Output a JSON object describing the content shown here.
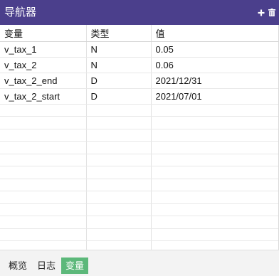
{
  "navigator": {
    "title": "导航器",
    "icons": {
      "add": "plus-icon",
      "delete": "trash-icon"
    },
    "columns": [
      "变量",
      "类型",
      "值"
    ],
    "rows": [
      {
        "name": "v_tax_1",
        "type": "N",
        "value": "0.05"
      },
      {
        "name": "v_tax_2",
        "type": "N",
        "value": "0.06"
      },
      {
        "name": "v_tax_2_end",
        "type": "D",
        "value": "2021/12/31"
      },
      {
        "name": "v_tax_2_start",
        "type": "D",
        "value": "2021/07/01"
      }
    ]
  },
  "tabs": [
    {
      "label": "概览",
      "active": false
    },
    {
      "label": "日志",
      "active": false
    },
    {
      "label": "变量",
      "active": true
    }
  ],
  "colors": {
    "titlebar": "#4b3f8c",
    "active_tab": "#5cb87a"
  }
}
